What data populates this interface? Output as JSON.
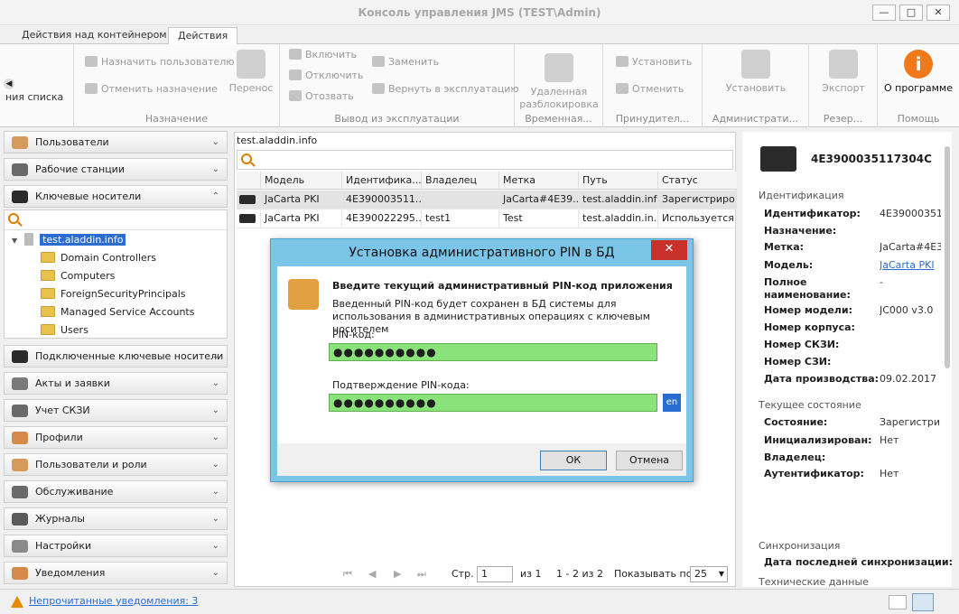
{
  "window": {
    "title": "Консоль управления JMS (TEST\\Admin)"
  },
  "tabs": [
    {
      "label": "Действия над контейнером"
    },
    {
      "label": "Действия"
    }
  ],
  "ribbon": {
    "partial_label": "ния списка",
    "assign": {
      "items": [
        "Назначить пользователю",
        "Отменить назначение"
      ],
      "big": "Перенос",
      "caption": "Назначение"
    },
    "decommission": {
      "items": [
        "Включить",
        "Отключить",
        "Отозвать",
        "Заменить",
        "Вернуть в эксплуатацию"
      ],
      "caption": "Вывод из эксплуатации"
    },
    "temp_unlock": {
      "big": "Удаленная разблокировка",
      "caption": "Временная..."
    },
    "forced": {
      "items": [
        "Установить",
        "Отменить"
      ],
      "caption": "Принудител..."
    },
    "admin": {
      "big": "Установить",
      "caption": "Администрати..."
    },
    "backup": {
      "big": "Экспорт",
      "caption": "Резер..."
    },
    "help": {
      "big": "О программе",
      "caption": "Помощь"
    }
  },
  "nav": {
    "sections": [
      {
        "label": "Пользователи"
      },
      {
        "label": "Рабочие станции"
      },
      {
        "label": "Ключевые носители"
      },
      {
        "label": "Подключенные ключевые носители"
      },
      {
        "label": "Акты и заявки"
      },
      {
        "label": "Учет СКЗИ"
      },
      {
        "label": "Профили"
      },
      {
        "label": "Пользователи и роли"
      },
      {
        "label": "Обслуживание"
      },
      {
        "label": "Журналы"
      },
      {
        "label": "Настройки"
      },
      {
        "label": "Уведомления"
      }
    ],
    "tree": {
      "root": "test.aladdin.info",
      "children": [
        "Domain Controllers",
        "Computers",
        "ForeignSecurityPrincipals",
        "Managed Service Accounts",
        "Users"
      ]
    }
  },
  "grid": {
    "breadcrumb": "test.aladdin.info",
    "columns": [
      "Модель",
      "Идентифика...",
      "Владелец",
      "Метка",
      "Путь",
      "Статус"
    ],
    "rows": [
      [
        "JaCarta PKI",
        "4E390003511...",
        "",
        "JaCarta#4E39...",
        "test.aladdin.info",
        "Зарегистриро..."
      ],
      [
        "JaCarta PKI",
        "4E390022295...",
        "test1",
        "Test",
        "test.aladdin.in...",
        "Используется"
      ]
    ],
    "pager": {
      "page_label": "Стр.",
      "page_value": "1",
      "of_pages": "из 1",
      "range": "1 - 2 из 2",
      "show_label": "Показывать по",
      "show_value": "25"
    }
  },
  "details": {
    "card_id": "4E3900035117304C",
    "sections": {
      "identification": "Идентификация",
      "state": "Текущее состояние",
      "sync": "Синхронизация",
      "tech": "Технические данные"
    },
    "identification": [
      {
        "label": "Идентификатор:",
        "value": "4E390003511"
      },
      {
        "label": "Назначение:",
        "value": ""
      },
      {
        "label": "Метка:",
        "value": "JaCarta#4E39"
      },
      {
        "label": "Модель:",
        "value": "JaCarta PKI"
      },
      {
        "label": "Полное наименование:",
        "value": "-"
      },
      {
        "label": "Номер модели:",
        "value": "JC000 v3.0"
      },
      {
        "label": "Номер корпуса:",
        "value": ""
      },
      {
        "label": "Номер СКЗИ:",
        "value": ""
      },
      {
        "label": "Номер СЗИ:",
        "value": ""
      },
      {
        "label": "Дата производства:",
        "value": "09.02.2017"
      }
    ],
    "state": [
      {
        "label": "Состояние:",
        "value": "Зарегистриро"
      },
      {
        "label": "Инициализирован:",
        "value": "Нет"
      },
      {
        "label": "Владелец:",
        "value": ""
      },
      {
        "label": "Аутентификатор:",
        "value": "Нет"
      }
    ],
    "sync_label": "Дата последней синхронизации:"
  },
  "status": {
    "notifications_link": "Непрочитанные уведомления: 3"
  },
  "dialog": {
    "title": "Установка административного PIN в БД",
    "heading": "Введите текущий административный PIN-код приложения",
    "description": "Введенный PIN-код будет сохранен в БД системы для использования в административных операциях с ключевым носителем",
    "pin_label": "PIN-код:",
    "pin_value": "●●●●●●●●●●",
    "confirm_label": "Подтверждение PIN-кода:",
    "confirm_value": "●●●●●●●●●●",
    "lang": "en",
    "ok": "ОК",
    "cancel": "Отмена"
  },
  "colors": {
    "accent": "#4aa0cc",
    "pin_field": "#8ae27a",
    "selection": "#2b6cd1",
    "close": "#c9302c",
    "warning": "#e68a00"
  }
}
